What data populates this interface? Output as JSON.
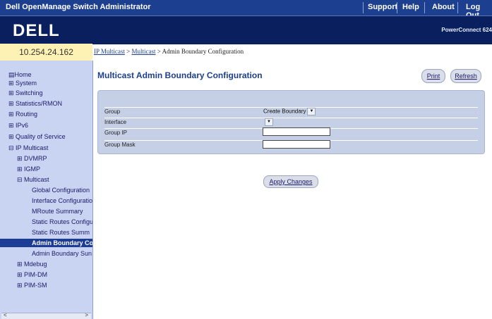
{
  "topbar": {
    "title": "Dell OpenManage Switch Administrator",
    "links": [
      "Support",
      "Help",
      "About",
      "Log Out"
    ]
  },
  "banner": {
    "logo": "DELL",
    "product": "PowerConnect 624"
  },
  "ip_address": "10.254.24.162",
  "breadcrumb": {
    "link1": "IP Multicast",
    "sep1": " > ",
    "link2": "Multicast",
    "sep2": " > ",
    "current": "Admin Boundary Configuration"
  },
  "page_title": "Multicast Admin Boundary Configuration",
  "buttons": {
    "print": "Print",
    "refresh": "Refresh",
    "apply": "Apply Changes"
  },
  "sidebar": {
    "items": [
      {
        "label": "▤Home",
        "level": 0
      },
      {
        "label": "⊞ System",
        "level": 0
      },
      {
        "label": "⊞ Switching",
        "level": 0
      },
      {
        "label": "⊞ Statistics/RMON",
        "level": 0
      },
      {
        "label": "⊞ Routing",
        "level": 0
      },
      {
        "label": "⊞ IPv6",
        "level": 0
      },
      {
        "label": "⊞ Quality of Service",
        "level": 0
      },
      {
        "label": "⊟ IP Multicast",
        "level": 0
      },
      {
        "label": "⊞ DVMRP",
        "level": 1
      },
      {
        "label": "⊞ IGMP",
        "level": 1
      },
      {
        "label": "⊟ Multicast",
        "level": 1
      },
      {
        "label": "Global Configuration",
        "level": 2
      },
      {
        "label": "Interface Configuratio",
        "level": 2
      },
      {
        "label": "MRoute Summary",
        "level": 2
      },
      {
        "label": "Static Routes Configu",
        "level": 2
      },
      {
        "label": "Static Routes Summ",
        "level": 2
      },
      {
        "label": "Admin Boundary Co",
        "level": 2,
        "selected": true
      },
      {
        "label": "Admin Boundary Sun",
        "level": 2
      },
      {
        "label": "⊞ Mdebug",
        "level": 1
      },
      {
        "label": "⊞ PIM-DM",
        "level": 1
      },
      {
        "label": "⊞ PIM-SM",
        "level": 1
      }
    ],
    "scroll_left": "<",
    "scroll_right": ">"
  },
  "form": {
    "group_label": "Group",
    "group_value": "Create Boundary",
    "interface_label": "Interface",
    "interface_value": "",
    "group_ip_label": "Group IP",
    "group_ip_value": "",
    "group_mask_label": "Group Mask",
    "group_mask_value": ""
  },
  "colors": {
    "topbar": "#1d3f90",
    "banner": "#0a1f5e",
    "sidebar": "#c9d4f2",
    "selected": "#1c3c96",
    "title": "#1d3f90"
  }
}
